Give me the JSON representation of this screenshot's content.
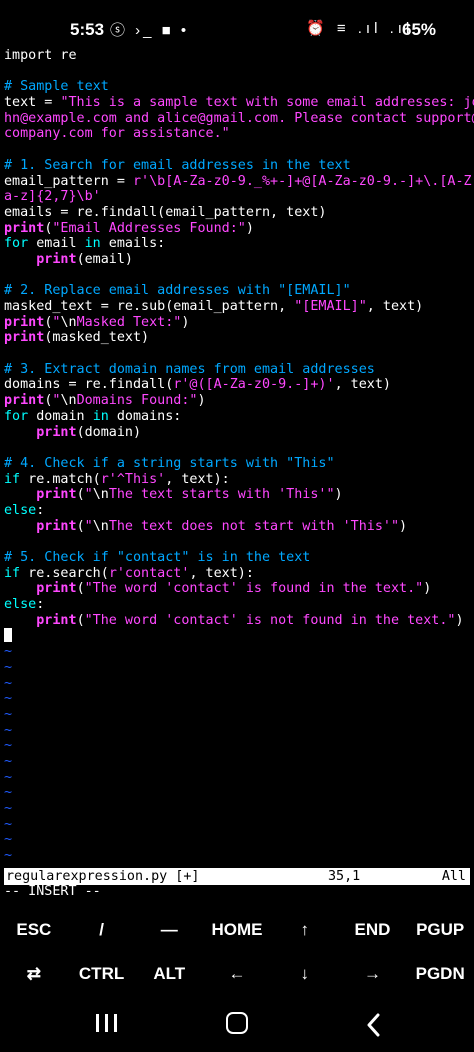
{
  "status_bar": {
    "time": "5:53",
    "left_icons": "ⓢ ›_ ■ •",
    "right_icons": "⏰ ≡ .ıl .ıl",
    "battery": "65%"
  },
  "editor": {
    "lines": [
      [
        {
          "c": "plain",
          "t": "import re"
        }
      ],
      [
        {
          "c": "plain",
          "t": ""
        }
      ],
      [
        {
          "c": "comment",
          "t": "# Sample text"
        }
      ],
      [
        {
          "c": "plain",
          "t": "text = "
        },
        {
          "c": "str",
          "t": "\"This is a sample text with some email addresses: jo"
        }
      ],
      [
        {
          "c": "str",
          "t": "hn@example.com and alice@gmail.com. Please contact support@"
        }
      ],
      [
        {
          "c": "str",
          "t": "company.com for assistance.\""
        }
      ],
      [
        {
          "c": "plain",
          "t": ""
        }
      ],
      [
        {
          "c": "comment",
          "t": "# 1. Search for email addresses in the text"
        }
      ],
      [
        {
          "c": "plain",
          "t": "email_pattern = "
        },
        {
          "c": "str",
          "t": "r'\\b[A-Za-z0-9._%+-]+@[A-Za-z0-9.-]+\\.[A-Z|"
        }
      ],
      [
        {
          "c": "str",
          "t": "a-z]{2,7}\\b'"
        }
      ],
      [
        {
          "c": "plain",
          "t": "emails = re.findall(email_pattern, text)"
        }
      ],
      [
        {
          "c": "fn",
          "t": "print"
        },
        {
          "c": "plain",
          "t": "("
        },
        {
          "c": "str",
          "t": "\"Email Addresses Found:\""
        },
        {
          "c": "plain",
          "t": ")"
        }
      ],
      [
        {
          "c": "kw",
          "t": "for"
        },
        {
          "c": "plain",
          "t": " email "
        },
        {
          "c": "kw",
          "t": "in"
        },
        {
          "c": "plain",
          "t": " emails:"
        }
      ],
      [
        {
          "c": "plain",
          "t": "    "
        },
        {
          "c": "fn",
          "t": "print"
        },
        {
          "c": "plain",
          "t": "(email)"
        }
      ],
      [
        {
          "c": "plain",
          "t": ""
        }
      ],
      [
        {
          "c": "comment",
          "t": "# 2. Replace email addresses with \"[EMAIL]\""
        }
      ],
      [
        {
          "c": "plain",
          "t": "masked_text = re.sub(email_pattern, "
        },
        {
          "c": "str",
          "t": "\"[EMAIL]\""
        },
        {
          "c": "plain",
          "t": ", text)"
        }
      ],
      [
        {
          "c": "fn",
          "t": "print"
        },
        {
          "c": "plain",
          "t": "("
        },
        {
          "c": "str",
          "t": "\""
        },
        {
          "c": "plain",
          "t": "\\n"
        },
        {
          "c": "str",
          "t": "Masked Text:\""
        },
        {
          "c": "plain",
          "t": ")"
        }
      ],
      [
        {
          "c": "fn",
          "t": "print"
        },
        {
          "c": "plain",
          "t": "(masked_text)"
        }
      ],
      [
        {
          "c": "plain",
          "t": ""
        }
      ],
      [
        {
          "c": "comment",
          "t": "# 3. Extract domain names from email addresses"
        }
      ],
      [
        {
          "c": "plain",
          "t": "domains = re.findall("
        },
        {
          "c": "str",
          "t": "r'@([A-Za-z0-9.-]+)'"
        },
        {
          "c": "plain",
          "t": ", text)"
        }
      ],
      [
        {
          "c": "fn",
          "t": "print"
        },
        {
          "c": "plain",
          "t": "("
        },
        {
          "c": "str",
          "t": "\""
        },
        {
          "c": "plain",
          "t": "\\n"
        },
        {
          "c": "str",
          "t": "Domains Found:\""
        },
        {
          "c": "plain",
          "t": ")"
        }
      ],
      [
        {
          "c": "kw",
          "t": "for"
        },
        {
          "c": "plain",
          "t": " domain "
        },
        {
          "c": "kw",
          "t": "in"
        },
        {
          "c": "plain",
          "t": " domains:"
        }
      ],
      [
        {
          "c": "plain",
          "t": "    "
        },
        {
          "c": "fn",
          "t": "print"
        },
        {
          "c": "plain",
          "t": "(domain)"
        }
      ],
      [
        {
          "c": "plain",
          "t": ""
        }
      ],
      [
        {
          "c": "comment",
          "t": "# 4. Check if a string starts with \"This\""
        }
      ],
      [
        {
          "c": "kw",
          "t": "if"
        },
        {
          "c": "plain",
          "t": " re.match("
        },
        {
          "c": "str",
          "t": "r'^This'"
        },
        {
          "c": "plain",
          "t": ", text):"
        }
      ],
      [
        {
          "c": "plain",
          "t": "    "
        },
        {
          "c": "fn",
          "t": "print"
        },
        {
          "c": "plain",
          "t": "("
        },
        {
          "c": "str",
          "t": "\""
        },
        {
          "c": "plain",
          "t": "\\n"
        },
        {
          "c": "str",
          "t": "The text starts with 'This'\""
        },
        {
          "c": "plain",
          "t": ")"
        }
      ],
      [
        {
          "c": "kw",
          "t": "else"
        },
        {
          "c": "plain",
          "t": ":"
        }
      ],
      [
        {
          "c": "plain",
          "t": "    "
        },
        {
          "c": "fn",
          "t": "print"
        },
        {
          "c": "plain",
          "t": "("
        },
        {
          "c": "str",
          "t": "\""
        },
        {
          "c": "plain",
          "t": "\\n"
        },
        {
          "c": "str",
          "t": "The text does not start with 'This'\""
        },
        {
          "c": "plain",
          "t": ")"
        }
      ],
      [
        {
          "c": "plain",
          "t": ""
        }
      ],
      [
        {
          "c": "comment",
          "t": "# 5. Check if \"contact\" is in the text"
        }
      ],
      [
        {
          "c": "kw",
          "t": "if"
        },
        {
          "c": "plain",
          "t": " re.search("
        },
        {
          "c": "str",
          "t": "r'contact'"
        },
        {
          "c": "plain",
          "t": ", text):"
        }
      ],
      [
        {
          "c": "plain",
          "t": "    "
        },
        {
          "c": "fn",
          "t": "print"
        },
        {
          "c": "plain",
          "t": "("
        },
        {
          "c": "str",
          "t": "\"The word 'contact' is found in the text.\""
        },
        {
          "c": "plain",
          "t": ")"
        }
      ],
      [
        {
          "c": "kw",
          "t": "else"
        },
        {
          "c": "plain",
          "t": ":"
        }
      ],
      [
        {
          "c": "plain",
          "t": "    "
        },
        {
          "c": "fn",
          "t": "print"
        },
        {
          "c": "plain",
          "t": "("
        },
        {
          "c": "str",
          "t": "\"The word 'contact' is not found in the text.\""
        },
        {
          "c": "plain",
          "t": ")"
        }
      ]
    ],
    "tilde": "~"
  },
  "vim": {
    "filename": "regularexpression.py [+]",
    "position": "35,1",
    "scroll": "All",
    "mode": "-- INSERT --"
  },
  "extra_keys": {
    "row1": [
      "ESC",
      "/",
      "—",
      "HOME",
      "↑",
      "END",
      "PGUP"
    ],
    "row2": [
      "⇄",
      "CTRL",
      "ALT",
      "←",
      "↓",
      "→",
      "PGDN"
    ]
  },
  "colors": {
    "keyword": "#00ffff",
    "string": "#ff48ff",
    "comment": "#00a8ff",
    "tilde": "#1f5bff"
  }
}
